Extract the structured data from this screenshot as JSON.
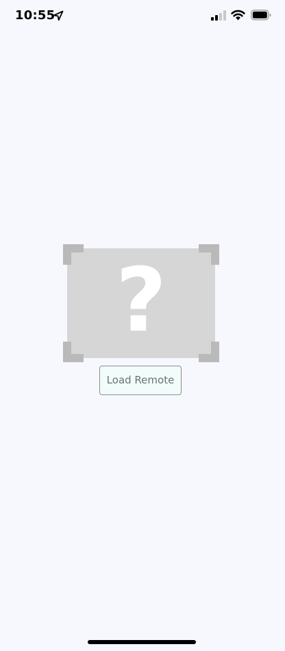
{
  "status_bar": {
    "time": "10:55",
    "location_icon": "location-arrow-icon",
    "signal_icon": "cellular-signal-icon",
    "wifi_icon": "wifi-icon",
    "battery_icon": "battery-icon"
  },
  "content": {
    "placeholder_icon": "missing-image-placeholder-icon",
    "placeholder_glyph": "?",
    "load_button_label": "Load Remote"
  },
  "colors": {
    "background": "#f7f8fe",
    "placeholder_fill": "#d6d6d6",
    "placeholder_corners": "#b9b9b9",
    "button_border": "#8a8f8f",
    "button_text": "#6d7272",
    "button_fill": "#f2fcfb"
  }
}
